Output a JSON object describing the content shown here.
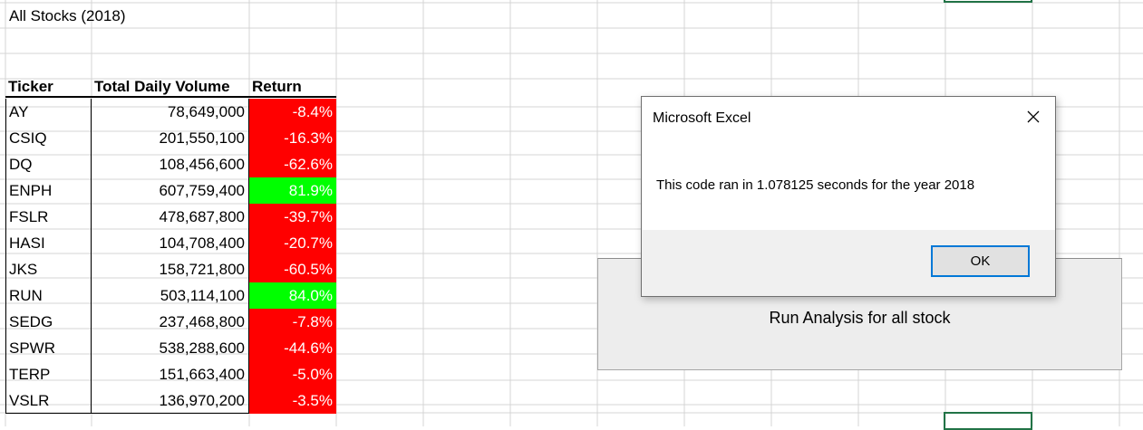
{
  "sheet": {
    "title": "All Stocks (2018)",
    "headers": {
      "ticker": "Ticker",
      "volume": "Total Daily Volume",
      "return": "Return"
    },
    "rows": [
      {
        "ticker": "AY",
        "volume": "78,649,000",
        "return": "-8.4%",
        "status": "negative"
      },
      {
        "ticker": "CSIQ",
        "volume": "201,550,100",
        "return": "-16.3%",
        "status": "negative"
      },
      {
        "ticker": "DQ",
        "volume": "108,456,600",
        "return": "-62.6%",
        "status": "negative"
      },
      {
        "ticker": "ENPH",
        "volume": "607,759,400",
        "return": "81.9%",
        "status": "positive"
      },
      {
        "ticker": "FSLR",
        "volume": "478,687,800",
        "return": "-39.7%",
        "status": "negative"
      },
      {
        "ticker": "HASI",
        "volume": "104,708,400",
        "return": "-20.7%",
        "status": "negative"
      },
      {
        "ticker": "JKS",
        "volume": "158,721,800",
        "return": "-60.5%",
        "status": "negative"
      },
      {
        "ticker": "RUN",
        "volume": "503,114,100",
        "return": "84.0%",
        "status": "positive"
      },
      {
        "ticker": "SEDG",
        "volume": "237,468,800",
        "return": "-7.8%",
        "status": "negative"
      },
      {
        "ticker": "SPWR",
        "volume": "538,288,600",
        "return": "-44.6%",
        "status": "negative"
      },
      {
        "ticker": "TERP",
        "volume": "151,663,400",
        "return": "-5.0%",
        "status": "negative"
      },
      {
        "ticker": "VSLR",
        "volume": "136,970,200",
        "return": "-3.5%",
        "status": "negative"
      }
    ]
  },
  "run_button": {
    "label": "Run Analysis for all stock"
  },
  "dialog": {
    "title": "Microsoft Excel",
    "message": "This code ran in 1.078125 seconds for the year 2018",
    "ok_label": "OK"
  },
  "colors": {
    "negative": "#ff0000",
    "positive": "#00ff00",
    "gridline": "#d4d4d4",
    "selection": "#217346",
    "button_focus": "#0078d7"
  }
}
